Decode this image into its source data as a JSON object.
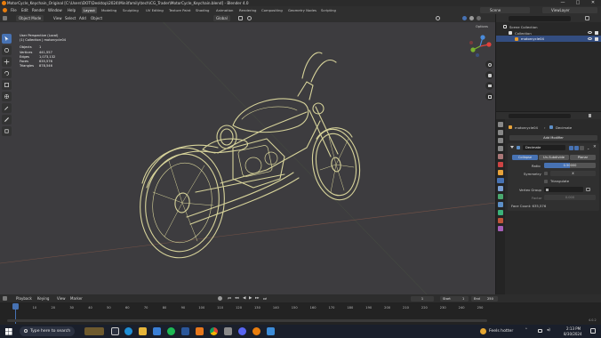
{
  "window": {
    "title": "MotorCycle_Keychain_Original [C:\\Users\\DOT\\Desktop\\2024\\Mini\\family\\tech\\CG_Trader\\MotorCycle_Keychain.blend] - Blender 4.0",
    "controls": [
      "—",
      "□",
      "✕"
    ]
  },
  "menu": {
    "items": [
      "File",
      "Edit",
      "Render",
      "Window",
      "Help"
    ],
    "workspaces": [
      "Layout",
      "Modeling",
      "Sculpting",
      "UV Editing",
      "Texture Paint",
      "Shading",
      "Animation",
      "Rendering",
      "Compositing",
      "Geometry Nodes",
      "Scripting"
    ],
    "active_workspace": "Layout",
    "scene": "Scene",
    "view_layer": "ViewLayer"
  },
  "viewport_header": {
    "mode": "Object Mode",
    "items": [
      "View",
      "Select",
      "Add",
      "Object"
    ],
    "orientation": "Global",
    "options_label": "Options"
  },
  "overlay": {
    "line1": "User Perspective (Local)",
    "line2": "(1) Collection | motorcycle04",
    "stats": [
      {
        "k": "Objects",
        "v": "1"
      },
      {
        "k": "Vertices",
        "v": "441,557"
      },
      {
        "k": "Edges",
        "v": "1,073,132"
      },
      {
        "k": "Faces",
        "v": "635,576"
      },
      {
        "k": "Triangles",
        "v": "878,546"
      }
    ]
  },
  "outliner": {
    "root": "Scene Collection",
    "collection": "Collection",
    "object": "motorcycle04"
  },
  "properties": {
    "object_name": "motorcycle04",
    "modifier_breadcrumb": "Decimate",
    "add_modifier": "Add Modifier",
    "modifier_name": "Decimate",
    "tabs": [
      "Collapse",
      "Un-Subdivide",
      "Planar"
    ],
    "active_tab": "Collapse",
    "ratio_label": "Ratio",
    "ratio_value": "0.50000",
    "symmetry_label": "Symmetry",
    "symmetry_value": "X",
    "triangulate_label": "Triangulate",
    "vertex_group_label": "Vertex Group",
    "factor_label": "Factor",
    "factor_value": "0.000",
    "face_count": "Face Count: 635,576"
  },
  "timeline": {
    "menu": [
      "Playback",
      "Keying",
      "View",
      "Marker"
    ],
    "current_frame": "1",
    "start_label": "Start",
    "start": "1",
    "end_label": "End",
    "end": "250",
    "ruler": [
      "0",
      "10",
      "20",
      "30",
      "40",
      "50",
      "60",
      "70",
      "80",
      "90",
      "100",
      "110",
      "120",
      "130",
      "140",
      "150",
      "160",
      "170",
      "180",
      "190",
      "200",
      "210",
      "220",
      "230",
      "240",
      "250"
    ],
    "version": "4.0.2"
  },
  "taskbar": {
    "search_placeholder": "Type here to search",
    "weather": "Feels hotter",
    "time": "2:13 PM",
    "date": "8/30/2024"
  },
  "colors": {
    "accent": "#4772b3",
    "model_line": "#d7d39a",
    "viewport_bg": "#3d3c3f"
  }
}
